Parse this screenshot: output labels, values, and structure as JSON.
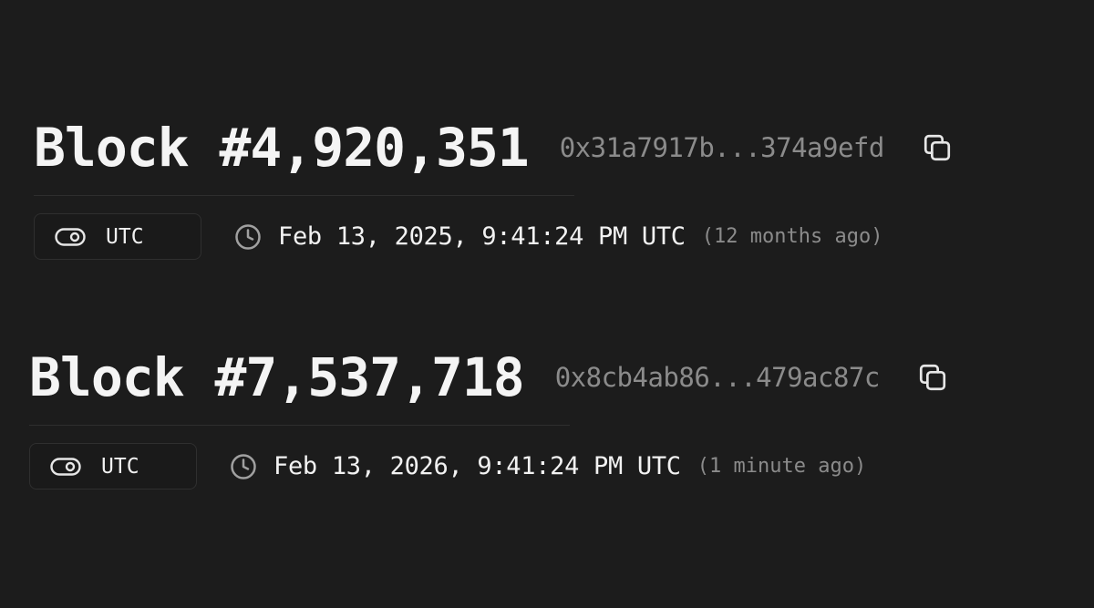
{
  "blocks": [
    {
      "title": "Block #4,920,351",
      "hash": "0x31a7917b...374a9efd",
      "timezone_label": "UTC",
      "timestamp": "Feb 13, 2025, 9:41:24 PM UTC",
      "relative_time": "(12 months ago)"
    },
    {
      "title": "Block #7,537,718",
      "hash": "0x8cb4ab86...479ac87c",
      "timezone_label": "UTC",
      "timestamp": "Feb 13, 2026, 9:41:24 PM UTC",
      "relative_time": "(1 minute ago)"
    }
  ],
  "icons": {
    "copy": "copy-icon",
    "toggle": "toggle-icon",
    "clock": "clock-icon"
  },
  "colors": {
    "background": "#1c1c1c",
    "text_primary": "#f2f2f2",
    "text_muted": "#8b8b8b"
  }
}
